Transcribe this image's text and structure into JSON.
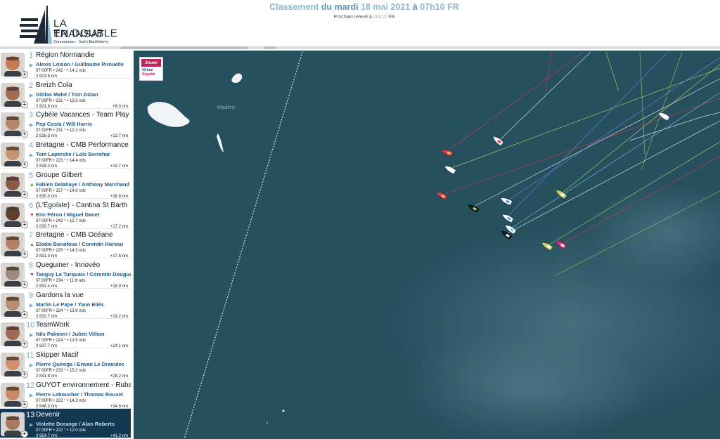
{
  "brand": {
    "title_line1": "LA TRANSAT",
    "title_line2": "EN DOUBLE",
    "subtitle": "Concarneau – Saint-Barthélemy"
  },
  "ranking_header": {
    "prefix": "Classement",
    "day_phrase": "du mardi",
    "date": "18 mai 2021",
    "at": "à",
    "time": "07h10 FR",
    "next_label": "Prochain relevé à",
    "next_time": "08h10",
    "next_zone": "FR"
  },
  "map": {
    "place_label": "Madère",
    "game_badge": {
      "play_label": "Jouer",
      "brand_line1": "Virtual",
      "brand_line2": "Regatta"
    }
  },
  "boats": [
    {
      "rank": "1",
      "name": "Région Normandie",
      "skippers": "Alexis Loison / Guillaume Pirouelle",
      "trend": "right",
      "position": "07:00FR • 242 ° • 14.1 nds",
      "distance": "2 813.5 nm",
      "gap": "",
      "avatar_color": "#c77a55"
    },
    {
      "rank": "2",
      "name": "Breizh Cola",
      "skippers": "Gildas Mahé / Tom Dolan",
      "trend": "right",
      "position": "07:00FR • 231 ° • 13.5 nds",
      "distance": "2 821.6 nm",
      "gap": "+8.0 nm",
      "avatar_color": "#a06d4f"
    },
    {
      "rank": "3",
      "name": "Cybèle Vacances - Team Play to B",
      "skippers": "Pep Costa / Will Harris",
      "trend": "right",
      "position": "07:00FR • 231 ° • 12.2 nds",
      "distance": "2 826.3 nm",
      "gap": "+12.7 nm",
      "avatar_color": "#b5856b"
    },
    {
      "rank": "4",
      "name": "Bretagne - CMB Performance",
      "skippers": "Tom Laperche / Loïs Berrehar",
      "trend": "right",
      "position": "07:00FR • 223 ° • 14.4 nds",
      "distance": "2 828.2 nm",
      "gap": "+14.7 nm",
      "avatar_color": "#c49171"
    },
    {
      "rank": "5",
      "name": "Groupe Gilbert",
      "skippers": "Fabien Delahaye / Anthony Marchand",
      "trend": "up",
      "position": "07:00FR • 227 ° • 14.6 nds",
      "distance": "2 830.3 nm",
      "gap": "+16.8 nm",
      "avatar_color": "#8a5a45"
    },
    {
      "rank": "6",
      "name": "(L'Égoïste) - Cantina St Barth",
      "skippers": "Eric Péron / Miguel Danet",
      "trend": "down",
      "position": "07:00FR • 242 ° • 12.7 nds",
      "distance": "2 830.7 nm",
      "gap": "+17.2 nm",
      "avatar_color": "#5e4030"
    },
    {
      "rank": "7",
      "name": "Bretagne - CMB Océane",
      "skippers": "Elodie Bonafous / Corentin Horeau",
      "trend": "up",
      "position": "07:00FR • 225 ° • 14.3 nds",
      "distance": "2 831.0 nm",
      "gap": "+17.5 nm",
      "avatar_color": "#b48066"
    },
    {
      "rank": "8",
      "name": "Queguiner - Innovéo",
      "skippers": "Tanguy Le Turquais / Corentin Douguet",
      "trend": "down",
      "position": "07:00FR • 234 ° • 11.8 nds",
      "distance": "2 832.4 nm",
      "gap": "+18.9 nm",
      "avatar_color": "#9d8a7c"
    },
    {
      "rank": "9",
      "name": "Gardons la vue",
      "skippers": "Martin Le Pape / Yann Eliès",
      "trend": "right",
      "position": "07:00FR • 224 ° • 13.9 nds",
      "distance": "2 832.7 nm",
      "gap": "+19.2 nm",
      "avatar_color": "#b98c74"
    },
    {
      "rank": "10",
      "name": "TeamWork",
      "skippers": "Nils Palmieri / Julien Villion",
      "trend": "right",
      "position": "07:00FR • 224 ° • 13.5 nds",
      "distance": "2 837.7 nm",
      "gap": "+24.1 nm",
      "avatar_color": "#9c6a52"
    },
    {
      "rank": "11",
      "name": "Skipper Macif",
      "skippers": "Pierre Quiroga / Erwan Le Draoulec",
      "trend": "right",
      "position": "07:00FR • 233 ° • 15.2 nds",
      "distance": "2 841.8 nm",
      "gap": "+28.2 nm",
      "avatar_color": "#d08f6a"
    },
    {
      "rank": "12",
      "name": "GUYOT environnement - Ruban Rose",
      "skippers": "Pierre Leboucher / Thomas Rouxel",
      "trend": "right",
      "position": "07:00FR • 222 ° • 14.3 nds",
      "distance": "2 848.3 nm",
      "gap": "+34.8 nm",
      "avatar_color": "#c98a66"
    },
    {
      "rank": "13",
      "name": "Devenir",
      "skippers": "Violette Dorange / Alan Roberts",
      "trend": "right",
      "position": "07:00FR • 222 ° • 12.0 nds",
      "distance": "2 854.7 nm",
      "gap": "+41.2 nm",
      "avatar_color": "#a77a60"
    }
  ],
  "colors": {
    "sea": "#27505f",
    "land": "#f2f4f5",
    "accent": "#8ab8cf",
    "selected_row": "#143852",
    "badge": "#c0245a"
  }
}
